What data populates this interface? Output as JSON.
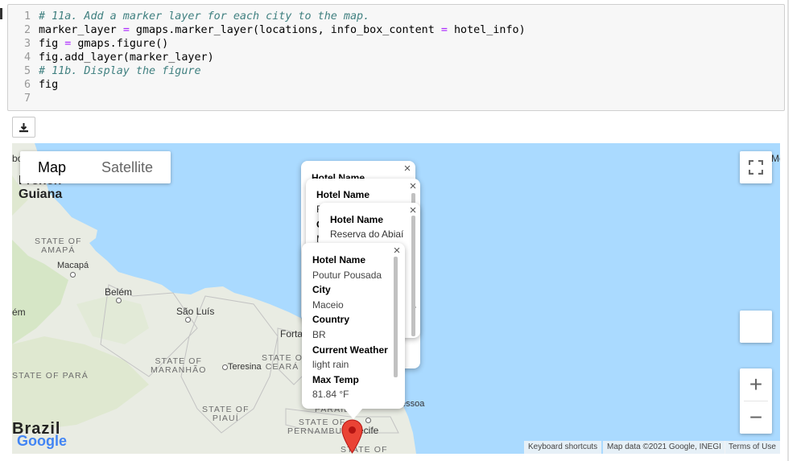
{
  "code": {
    "line_numbers": [
      "1",
      "2",
      "3",
      "4",
      "5",
      "6",
      "7"
    ],
    "lines": [
      {
        "parts": [
          {
            "t": "# 11a. Add a marker layer for each city to the map.",
            "c": "cm"
          }
        ]
      },
      {
        "parts": [
          {
            "t": "marker_layer ",
            "c": ""
          },
          {
            "t": "=",
            "c": "op"
          },
          {
            "t": " gmaps.marker_layer(locations, info_box_content ",
            "c": ""
          },
          {
            "t": "=",
            "c": "op"
          },
          {
            "t": " hotel_info)",
            "c": ""
          }
        ]
      },
      {
        "parts": [
          {
            "t": "fig ",
            "c": ""
          },
          {
            "t": "=",
            "c": "op"
          },
          {
            "t": " gmaps.figure()",
            "c": ""
          }
        ]
      },
      {
        "parts": [
          {
            "t": "fig.add_layer(marker_layer)",
            "c": ""
          }
        ]
      },
      {
        "parts": [
          {
            "t": "# 11b. Display the figure",
            "c": "cm"
          }
        ]
      },
      {
        "parts": [
          {
            "t": "fig",
            "c": ""
          }
        ]
      },
      {
        "parts": []
      }
    ]
  },
  "download": {
    "icon": "download-icon"
  },
  "map": {
    "type_buttons": {
      "map": "Map",
      "satellite": "Satellite"
    },
    "labels": {
      "edge_left_top": "bo",
      "edge_right_top": "Mc",
      "french_top": "French",
      "french_bottom": "Guiana",
      "macapa": "Macapá",
      "belem": "Belém",
      "sao_luis": "São Luís",
      "fortaleza": "Forta",
      "teresina": "Teresina",
      "pessoa": "essoa",
      "recife": "ecife",
      "edge_em": "ém",
      "brazil": "Brazil"
    },
    "states": {
      "amapa": "STATE OF\nAMAPÁ",
      "para": "STATE OF PARÁ",
      "maranhao": "STATE OF\nMARANHÃO",
      "ceara": "STATE O\nCEARÁ",
      "piaui": "STATE OF\nPIAUÍ",
      "paraiba": "PARAÍB",
      "pernambuco": "STATE OF\nPERNAMBUCO",
      "bottom": "STATE OF"
    },
    "attribution": {
      "shortcuts": "Keyboard shortcuts",
      "data": "Map data ©2021 Google, INEGI",
      "terms": "Terms of Use"
    },
    "google_logo": "Google",
    "zoom": {
      "in": "+",
      "out": "−"
    },
    "fullscreen_icon": "fullscreen-icon",
    "info_windows": {
      "back1": {
        "title": "Hotel Name",
        "frag1": "",
        "frag2": ""
      },
      "back2": {
        "title": "Hotel Name",
        "frag1": "F",
        "frag2": "C",
        "frag3": "M"
      },
      "back3": {
        "title": "Hotel Name",
        "hotel": "Reserva do Abiaí",
        "frag": "r"
      },
      "front": {
        "hotel_label": "Hotel Name",
        "hotel_value": "Poutur Pousada",
        "city_label": "City",
        "city_value": "Maceio",
        "country_label": "Country",
        "country_value": "BR",
        "weather_label": "Current Weather",
        "weather_value": "light rain",
        "temp_label": "Max Temp",
        "temp_value": "81.84 °F"
      },
      "close": "×"
    },
    "marker_color": "#ea4335"
  }
}
